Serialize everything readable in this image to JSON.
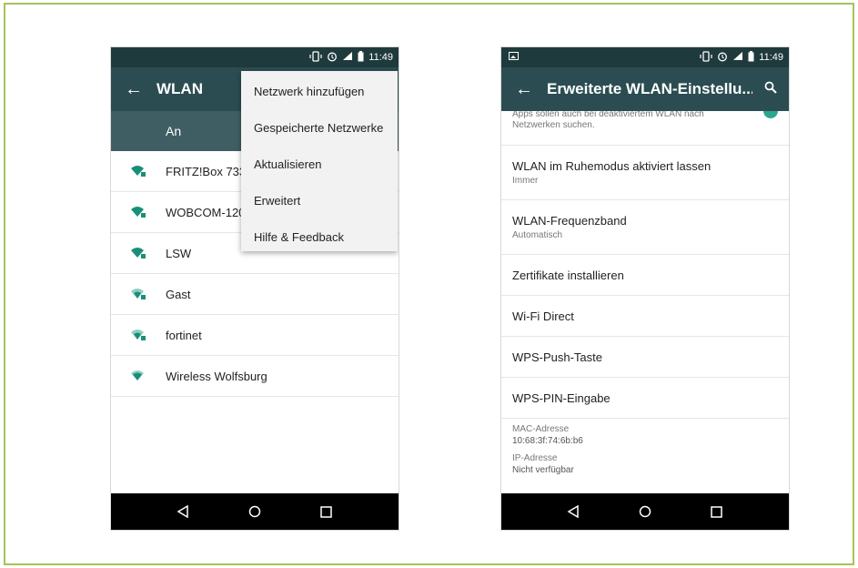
{
  "left_phone": {
    "status_time": "11:49",
    "app_title": "WLAN",
    "toggle_label": "An",
    "networks": [
      {
        "name": "FRITZ!Box 733"
      },
      {
        "name": "WOBCOM-120"
      },
      {
        "name": "LSW"
      },
      {
        "name": "Gast"
      },
      {
        "name": "fortinet"
      },
      {
        "name": "Wireless Wolfsburg"
      }
    ],
    "menu": [
      {
        "label": "Netzwerk hinzufügen"
      },
      {
        "label": "Gespeicherte Netzwerke"
      },
      {
        "label": "Aktualisieren"
      },
      {
        "label": "Erweitert"
      },
      {
        "label": "Hilfe & Feedback"
      }
    ]
  },
  "right_phone": {
    "status_time": "11:49",
    "app_title": "Erweiterte WLAN-Einstellu...",
    "partial_text": "Apps sollen auch bei deaktiviertem WLAN nach Netzwerken suchen.",
    "settings": [
      {
        "title": "WLAN im Ruhemodus aktiviert lassen",
        "sub": "Immer"
      },
      {
        "title": "WLAN-Frequenzband",
        "sub": "Automatisch"
      },
      {
        "title": "Zertifikate installieren"
      },
      {
        "title": "Wi-Fi Direct"
      },
      {
        "title": "WPS-Push-Taste"
      },
      {
        "title": "WPS-PIN-Eingabe"
      }
    ],
    "mac_label": "MAC-Adresse",
    "mac_value": "10:68:3f:74:6b:b6",
    "ip_label": "IP-Adresse",
    "ip_value": "Nicht verfügbar"
  },
  "colors": {
    "frame_border": "#a6c35a",
    "status_bar": "#1f3a3d",
    "app_bar": "#2b4d52",
    "toggle_bar": "#3f5e63",
    "wifi_icon": "#1a8f78",
    "accent": "#2ea58e"
  }
}
